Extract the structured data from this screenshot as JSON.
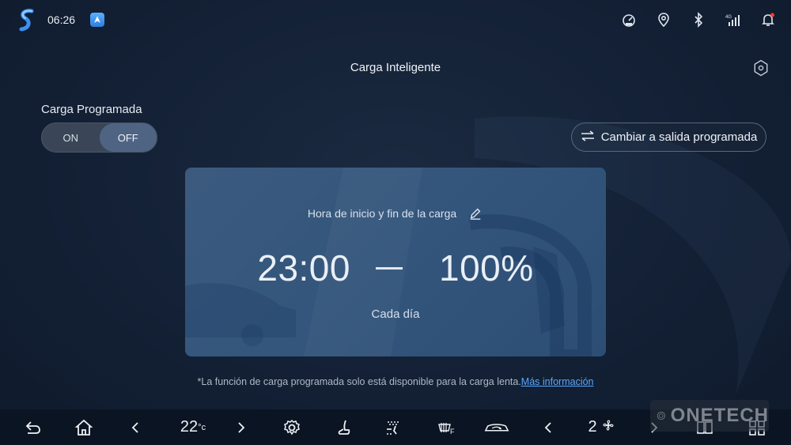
{
  "status": {
    "time": "06:26",
    "network": "4G"
  },
  "header": {
    "title": "Carga Inteligente"
  },
  "schedule": {
    "label": "Carga Programada",
    "on_label": "ON",
    "off_label": "OFF",
    "selected": "OFF"
  },
  "switch_button": {
    "label": "Cambiar a salida programada"
  },
  "card": {
    "subtitle": "Hora de inicio y fin de la carga",
    "start_time": "23:00",
    "target": "100%",
    "frequency": "Cada día"
  },
  "note": {
    "text": "*La función de carga programada solo está disponible para la carga lenta.",
    "link": "Más información"
  },
  "bottombar": {
    "temperature": "22",
    "temp_unit": "°c",
    "fan_speed": "2",
    "defrost_label": "F"
  },
  "watermark": "ONETECH",
  "colors": {
    "background": "#132035",
    "card": "#35567b",
    "link": "#58a8ff",
    "toggle_active": "#4f6483"
  }
}
